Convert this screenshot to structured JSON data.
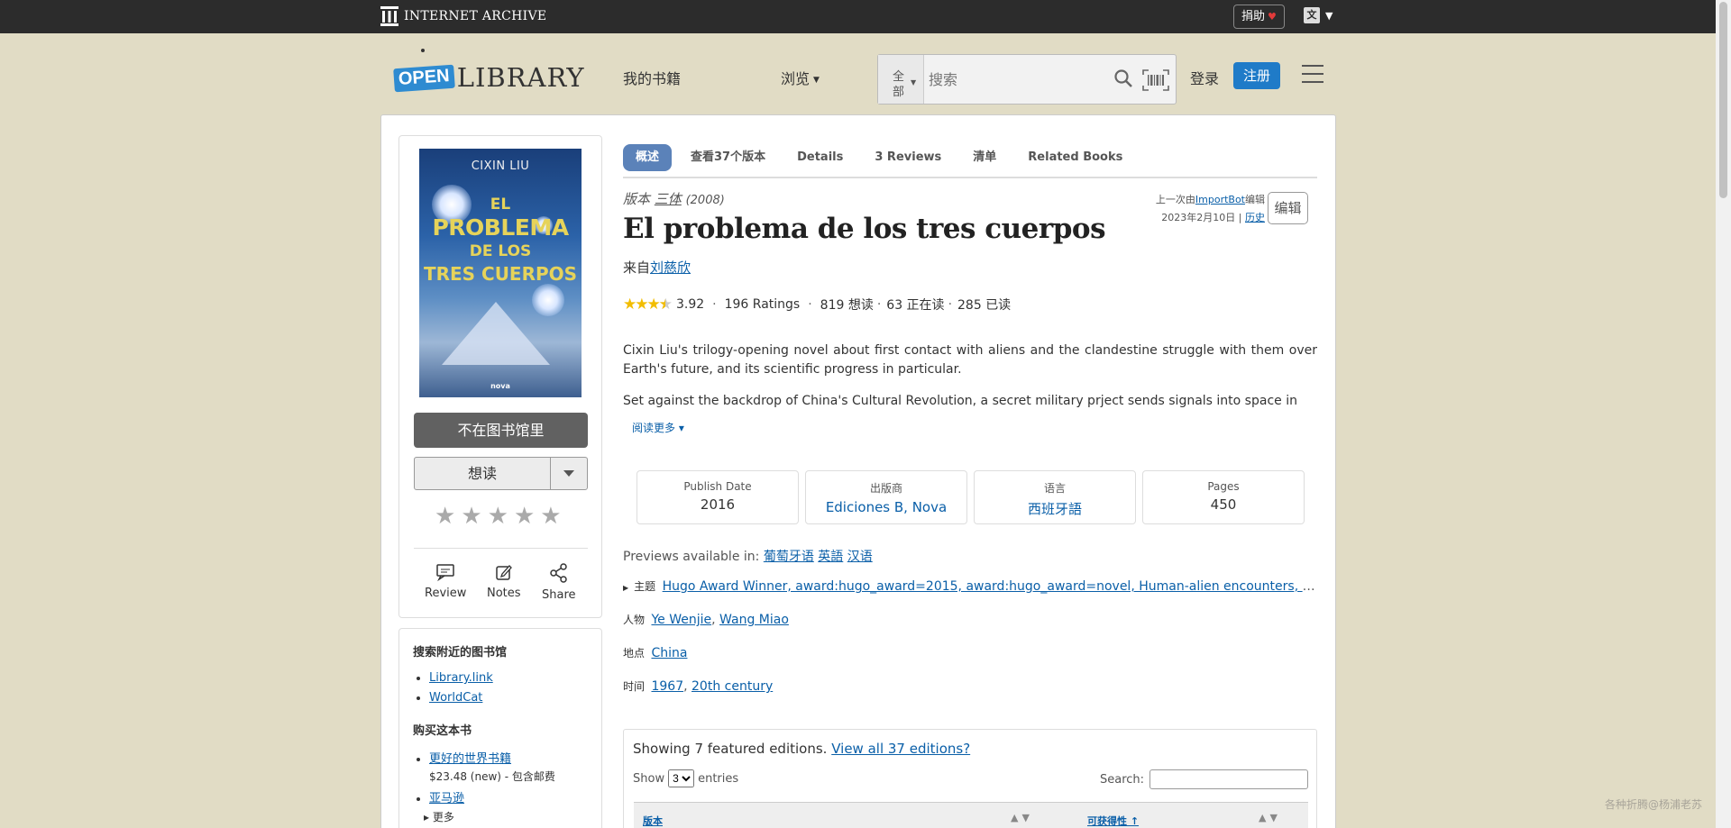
{
  "ia_bar": {
    "logo_text": "INTERNET ARCHIVE",
    "donate_label": "捐助",
    "donate_heart": "♥",
    "lang_icon": "文",
    "lang_caret": "▼"
  },
  "header": {
    "logo_open": "OPEN",
    "logo_library": "LIBRARY",
    "nav_my_books": "我的书籍",
    "nav_browse": "浏览",
    "search_category": "全部",
    "search_placeholder": "搜索",
    "login": "登录",
    "signup": "注册"
  },
  "cover": {
    "author": "CIXIN LIU",
    "line1": "EL",
    "line2": "PROBLEMA",
    "line3": "DE LOS",
    "line4": "TRES CUERPOS",
    "publisher_mark": "nova"
  },
  "left": {
    "not_in_library": "不在图书馆里",
    "want_to_read": "想读",
    "rating_stars": [
      "★",
      "★",
      "★",
      "★",
      "★"
    ],
    "actions": {
      "review": "Review",
      "notes": "Notes",
      "share": "Share"
    },
    "nearby_heading": "搜索附近的图书馆",
    "nearby_links": [
      "Library.link",
      "WorldCat"
    ],
    "buy_heading": "购买这本书",
    "buy_links": [
      {
        "label": "更好的世界书籍",
        "price": "$23.48 (new) - 包含邮费"
      },
      {
        "label": "亚马逊"
      }
    ],
    "more": "▸ 更多"
  },
  "tabs": [
    "概述",
    "查看37个版本",
    "Details",
    "3 Reviews",
    "清单",
    "Related Books"
  ],
  "book": {
    "edition_prefix": "版本",
    "edition_work": "三体",
    "edition_year": "(2008)",
    "last_edit_prefix": "上一次由",
    "last_edit_user": "ImportBot",
    "last_edit_suffix": "编辑",
    "last_edit_date": "2023年2月10日",
    "history": "历史",
    "edit_button": "编辑",
    "title": "El problema de los tres cuerpos",
    "by_prefix": "来自",
    "author": "刘慈欣",
    "rating": "3.92",
    "ratings_count": "196 Ratings",
    "want_to_read_count": "819 想读",
    "currently_reading": "63 正在读",
    "already_read": "285 已读",
    "desc1": "Cixin Liu's trilogy-opening novel about first contact with aliens and the clandestine struggle with them over Earth's future, and its scientific progress in particular.",
    "desc2": "Set against the backdrop of China's Cultural Revolution, a secret military prject sends signals into space in",
    "read_more": "阅读更多 ▾"
  },
  "info": [
    {
      "key": "Publish Date",
      "value": "2016"
    },
    {
      "key": "出版商",
      "value": "Ediciones B, Nova"
    },
    {
      "key": "语言",
      "value": "西班牙語"
    },
    {
      "key": "Pages",
      "value": "450"
    }
  ],
  "previews": {
    "label": "Previews available in:",
    "langs": [
      "葡萄牙语",
      "英語",
      "汉语"
    ]
  },
  "subjects": {
    "label": "主题",
    "items": "Hugo Award Winner, award:hugo_award=2015, award:hugo_award=novel, Human-alien encounters, Fiction, Life on other planets, Nanotechnology"
  },
  "people": {
    "label": "人物",
    "items": [
      "Ye Wenjie",
      "Wang Miao"
    ]
  },
  "places": {
    "label": "地点",
    "items": [
      "China"
    ]
  },
  "times": {
    "label": "时间",
    "items": [
      "1967",
      "20th century"
    ]
  },
  "editions": {
    "showing": "Showing 7 featured editions.",
    "view_all": "View all 37 editions?",
    "show_label": "Show",
    "show_value": "3",
    "entries_label": "entries",
    "search_label": "Search:",
    "col1": "版本",
    "col2": "可获得性 ↑"
  },
  "watermark": "各种折腾@杨浦老苏"
}
